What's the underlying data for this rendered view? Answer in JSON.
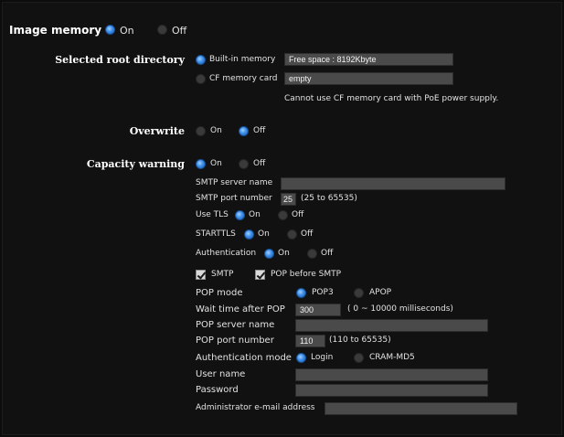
{
  "image_memory": {
    "label": "Image memory",
    "on": "On",
    "off": "Off"
  },
  "root_directory": {
    "label": "Selected root directory",
    "builtin_label": "Built-in memory",
    "builtin_value": "Free space : 8192Kbyte",
    "cf_label": "CF memory card",
    "cf_value": "empty",
    "note": "Cannot use CF memory card with PoE power supply."
  },
  "overwrite": {
    "label": "Overwrite",
    "on": "On",
    "off": "Off"
  },
  "capacity_warning": {
    "label": "Capacity warning",
    "on": "On",
    "off": "Off"
  },
  "smtp": {
    "server_name_label": "SMTP server name",
    "server_name_value": "",
    "port_label": "SMTP port number",
    "port_value": "25",
    "port_range": "(25 to 65535)",
    "tls_label": "Use TLS",
    "tls_on": "On",
    "tls_off": "Off",
    "starttls_label": "STARTTLS",
    "starttls_on": "On",
    "starttls_off": "Off",
    "auth_label": "Authentication",
    "auth_on": "On",
    "auth_off": "Off"
  },
  "checks": {
    "smtp": "SMTP",
    "pop_before_smtp": "POP before SMTP"
  },
  "pop": {
    "mode_label": "POP mode",
    "mode_pop3": "POP3",
    "mode_apop": "APOP",
    "wait_label": "Wait time after POP",
    "wait_value": "300",
    "wait_range": "( 0 ~ 10000 milliseconds)",
    "server_label": "POP server name",
    "server_value": "",
    "port_label": "POP port number",
    "port_value": "110",
    "port_range": "(110 to 65535)",
    "auth_mode_label": "Authentication mode",
    "auth_login": "Login",
    "auth_cram": "CRAM-MD5",
    "user_label": "User name",
    "user_value": "",
    "password_label": "Password",
    "password_value": "",
    "admin_label": "Administrator e-mail address",
    "admin_value": ""
  },
  "colors": {
    "background": "#111111",
    "field": "#4a4a4a",
    "radio_selected": "#3d8ee8"
  }
}
